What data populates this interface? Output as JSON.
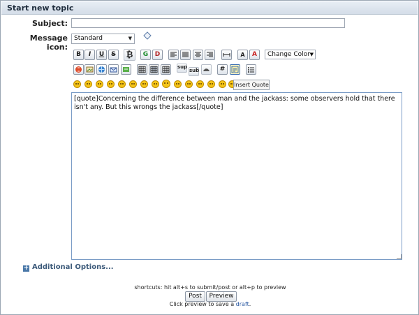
{
  "title": "Start new topic",
  "form": {
    "subject_label": "Subject:",
    "subject_value": "",
    "icon_label": "Message icon:",
    "icon_value": "Standard"
  },
  "toolbar": {
    "bold": "B",
    "italic": "I",
    "underline": "U",
    "strike": "S",
    "glow": "G",
    "shadow": "D",
    "font_face": "A",
    "font_color": "A",
    "change_color": "Change Color",
    "sup": "sup",
    "sub": "sub",
    "code": "#",
    "insert_quote_tooltip": "Insert Quote"
  },
  "message": "[quote]Concerning the difference between man and the jackass: some observers hold that there isn't any. But this wrongs the jackass[/quote]",
  "additional_options": "Additional Options...",
  "shortcuts": "shortcuts: hit alt+s to submit/post or alt+p to preview",
  "buttons": {
    "post": "Post",
    "preview": "Preview"
  },
  "draft": {
    "prefix": "Click preview to save a ",
    "link": "draft",
    "suffix": "."
  }
}
